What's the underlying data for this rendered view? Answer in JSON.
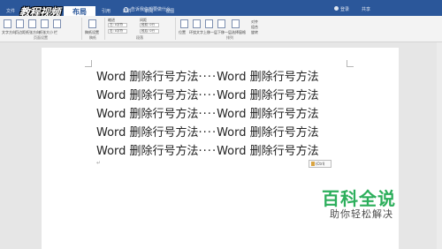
{
  "tabs": [
    "文件",
    "开始",
    "插入",
    "设计",
    "布局",
    "引用",
    "邮件",
    "审阅",
    "视图"
  ],
  "active_tab": "布局",
  "watermark": "教程视频",
  "tell_me": "告诉我你想要做什么",
  "top_right": {
    "user": "登录",
    "share": "共享"
  },
  "ribbon": {
    "groups": [
      {
        "label": "页面设置",
        "buttons": [
          "文字方向",
          "页边距",
          "纸张方向",
          "纸张大小",
          "栏"
        ]
      },
      {
        "label": "稿纸",
        "buttons": [
          "稿纸设置"
        ]
      },
      {
        "label": "段落",
        "indent_title": "缩进",
        "spacing_title": "间距",
        "indent_left": "左: 0字符",
        "indent_right": "右: 0字符",
        "space_before": "段前: 0行",
        "space_after": "段后: 0行"
      },
      {
        "label": "排列",
        "buttons": [
          "位置",
          "环绕文字",
          "上移一层",
          "下移一层",
          "选择窗格",
          "对齐",
          "组合",
          "旋转"
        ]
      }
    ]
  },
  "document": {
    "lines": [
      {
        "a": "Word 删除行号方法",
        "dots": "····",
        "b": "Word 删除行号方法"
      },
      {
        "a": "Word 删除行号方法",
        "dots": "····",
        "b": "Word 删除行号方法"
      },
      {
        "a": "Word 删除行号方法",
        "dots": "····",
        "b": "Word 删除行号方法"
      },
      {
        "a": "Word 删除行号方法",
        "dots": "····",
        "b": "Word 删除行号方法"
      },
      {
        "a": "Word 删除行号方法",
        "dots": "····",
        "b": "Word 删除行号方法"
      }
    ],
    "paste_options": "(Ctrl)"
  },
  "logo": {
    "title": "百科全说",
    "subtitle": "助你轻松解决"
  }
}
